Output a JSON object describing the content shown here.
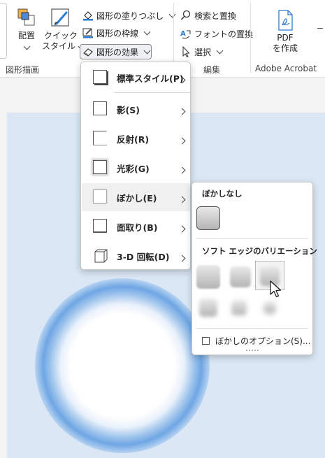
{
  "ribbon": {
    "arrange_label": "配置",
    "quick_style_line1": "クイック",
    "quick_style_line2": "スタイル",
    "shape_fill": "図形の塗りつぶし",
    "shape_outline": "図形の枠線",
    "shape_effects": "図形の効果",
    "find_replace": "検索と置換",
    "font_replace": "フォントの置換",
    "select": "選択",
    "pdf_line1": "PDF",
    "pdf_line2": "を作成",
    "group_drawing": "図形描画",
    "group_editing": "編集",
    "group_acrobat": "Adobe Acrobat"
  },
  "effects_menu": {
    "items": [
      {
        "label": "標準スタイル(P)",
        "icon": "preset-style-icon"
      },
      {
        "label": "影(S)",
        "icon": "shadow-icon"
      },
      {
        "label": "反射(R)",
        "icon": "reflection-icon"
      },
      {
        "label": "光彩(G)",
        "icon": "glow-icon"
      },
      {
        "label": "ぼかし(E)",
        "icon": "soft-edges-icon"
      },
      {
        "label": "面取り(B)",
        "icon": "bevel-icon"
      },
      {
        "label": "3-D 回転(D)",
        "icon": "3d-rotation-icon"
      }
    ],
    "highlighted_index": 4
  },
  "soft_edges_menu": {
    "no_soft_edge_heading": "ぼかしなし",
    "variations_heading": "ソフト エッジのバリエーション",
    "options_label": "ぼかしのオプション(S)...",
    "selected_variation": 3
  },
  "colors": {
    "canvas": "#dbe7f5",
    "ring": "#6ea6e4",
    "accent": "#185abd"
  }
}
